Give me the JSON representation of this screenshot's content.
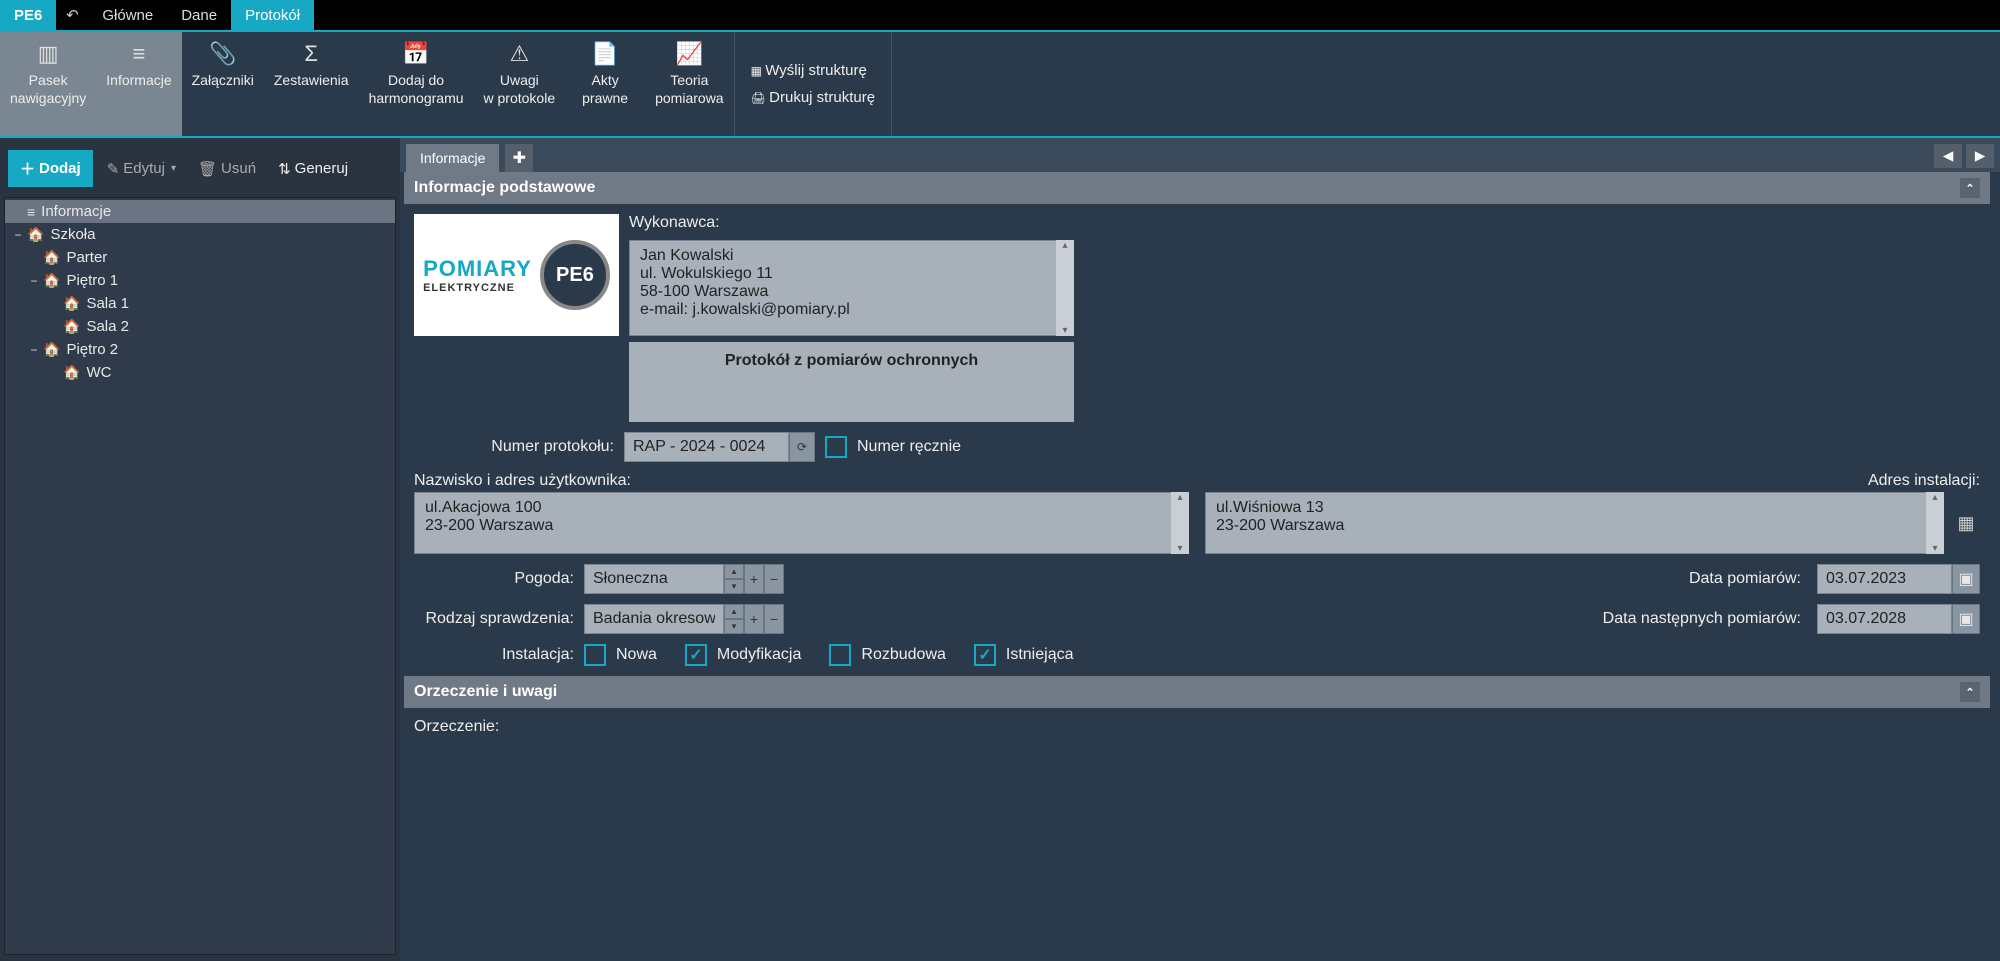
{
  "app": {
    "logo": "PE6"
  },
  "menu": {
    "main": "Główne",
    "data": "Dane",
    "protocol": "Protokół"
  },
  "ribbon": {
    "nav_panel": "Pasek\nnawigacyjny",
    "info": "Informacje",
    "attachments": "Załączniki",
    "summaries": "Zestawienia",
    "add_schedule": "Dodaj do\nharmonogramu",
    "notes": "Uwagi\nw protokole",
    "legal": "Akty\nprawne",
    "theory": "Teoria\npomiarowa",
    "send_structure": "Wyślij strukturę",
    "print_structure": "Drukuj strukturę"
  },
  "left": {
    "add": "Dodaj",
    "edit": "Edytuj",
    "delete": "Usuń",
    "generate": "Generuj",
    "tree": {
      "info": "Informacje",
      "school": "Szkoła",
      "parter": "Parter",
      "floor1": "Piętro 1",
      "room1": "Sala 1",
      "room2": "Sala 2",
      "floor2": "Piętro 2",
      "wc": "WC"
    }
  },
  "tabs": {
    "info": "Informacje"
  },
  "section": {
    "basic_info": "Informacje podstawowe",
    "orzeczenie": "Orzeczenie i uwagi"
  },
  "logo": {
    "line1": "POMIARY",
    "line2": "ELEKTRYCZNE",
    "badge": "PE6"
  },
  "form": {
    "contractor_label": "Wykonawca:",
    "contractor_value": "Jan Kowalski\nul. Wokulskiego 11\n58-100 Warszawa\ne-mail: j.kowalski@pomiary.pl",
    "title_value": "Protokół z pomiarów ochronnych",
    "protocol_no_label": "Numer protokołu:",
    "protocol_no_value": "RAP - 2024 - 0024",
    "manual_no_label": "Numer ręcznie",
    "user_name_addr_label": "Nazwisko i adres użytkownika:",
    "user_name_addr_value": "ul.Akacjowa 100\n23-200 Warszawa",
    "install_addr_label": "Adres instalacji:",
    "install_addr_value": "ul.Wiśniowa 13\n23-200 Warszawa",
    "weather_label": "Pogoda:",
    "weather_value": "Słoneczna",
    "check_type_label": "Rodzaj sprawdzenia:",
    "check_type_value": "Badania okresowe",
    "date_label": "Data pomiarów:",
    "date_value": "03.07.2023",
    "next_date_label": "Data następnych pomiarów:",
    "next_date_value": "03.07.2028",
    "installation_label": "Instalacja:",
    "inst_new": "Nowa",
    "inst_mod": "Modyfikacja",
    "inst_ext": "Rozbudowa",
    "inst_exist": "Istniejąca",
    "orzeczenie_label": "Orzeczenie:"
  }
}
